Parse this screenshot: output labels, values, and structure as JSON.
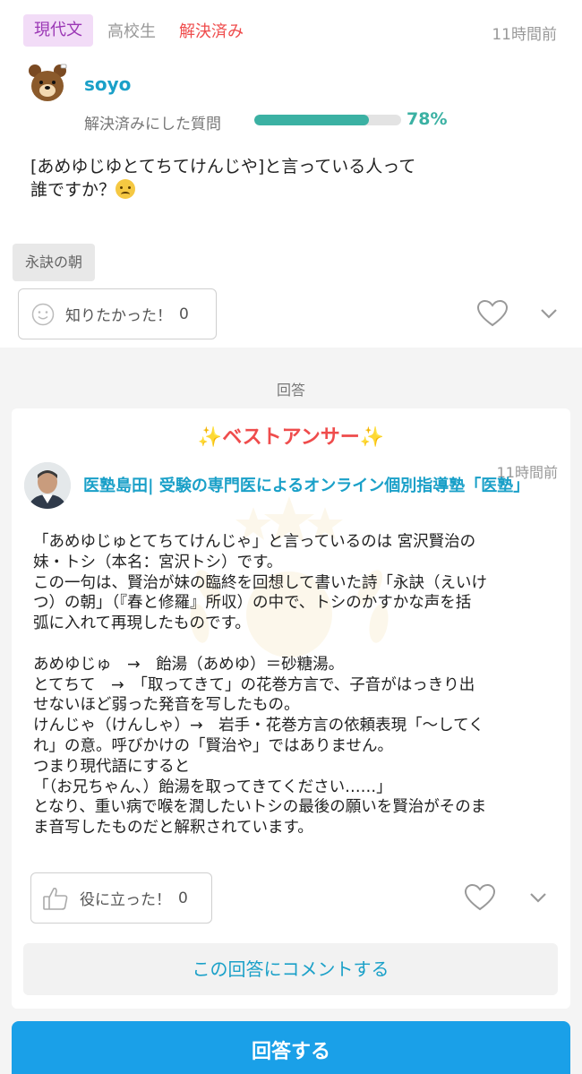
{
  "question": {
    "subject_tag": "現代文",
    "grade_tag": "高校生",
    "status_tag": "解決済み",
    "time": "11時間前",
    "user": {
      "name": "soyo",
      "avatar_icon": "bear-avatar-icon"
    },
    "resolution": {
      "label": "解決済みにした質問",
      "percent": 78,
      "percent_text": "78%"
    },
    "text_line1": "[あめゆじゆとてちてけんじや]と言っている人って",
    "text_line2": "誰ですか？",
    "topic_chip": "永訣の朝",
    "want_to_know": {
      "label": "知りたかった！",
      "count": "0"
    }
  },
  "answers_heading": "回答",
  "answer": {
    "best_label": "ベストアンサー",
    "time": "11時間前",
    "user_name": "医塾島田| 受験の専門医によるオンライン個別指導塾「医塾」",
    "body_lines": [
      "「あめゆじゅとてちてけんじゃ」と言っているのは 宮沢賢治の",
      "妹・トシ（本名：宮沢トシ）です。",
      "この一句は、賢治が妹の臨終を回想して書いた詩「永訣（えいけ",
      "つ）の朝」（『春と修羅』所収）の中で、トシのかすかな声を括",
      "弧に入れて再現したものです。",
      "",
      "あめゆじゅ　→　飴湯（あめゆ）＝砂糖湯。",
      "とてちて　→　「取ってきて」の花巻方言で、子音がはっきり出",
      "せないほど弱った発音を写したもの。",
      "けんじゃ（けんしゃ）→　岩手・花巻方言の依頼表現「〜してく",
      "れ」の意。呼びかけの「賢治や」ではありません。",
      "つまり現代語にすると",
      "「（お兄ちゃん、）飴湯を取ってきてください……」",
      "となり、重い病で喉を潤したいトシの最後の願いを賢治がそのま",
      "ま音写したものだと解釈されています。"
    ],
    "helpful": {
      "label": "役に立った！",
      "count": "0"
    },
    "comment_button": "この回答にコメントする"
  },
  "answer_button": "回答する",
  "colors": {
    "accent": "#1aa0c8",
    "solved_red": "#ef4c4c",
    "progress_teal": "#3bb1a3",
    "answer_button_bg": "#1aa0e8"
  }
}
